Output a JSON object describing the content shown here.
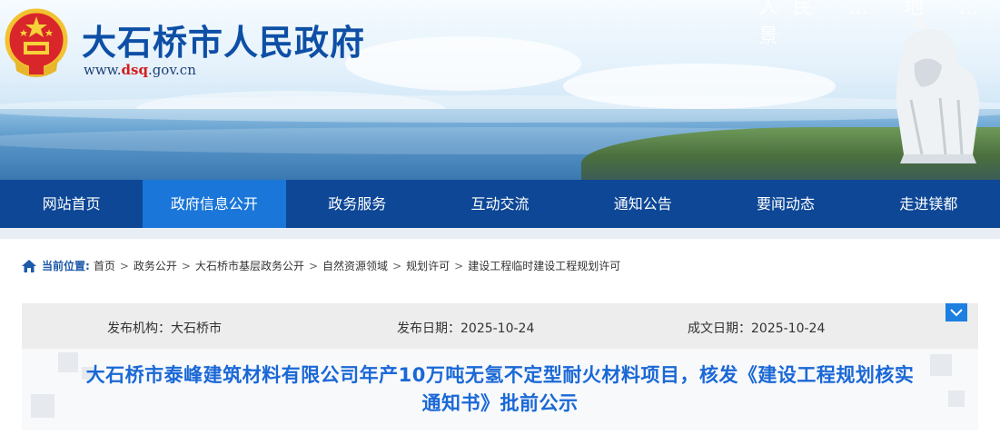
{
  "header": {
    "site_title": "大石桥市人民政府",
    "url_prefix": "www.",
    "url_highlight": "dsq",
    "url_suffix": ".gov.cn",
    "slogan": "人民 … 地 … 景"
  },
  "nav": {
    "items": [
      {
        "label": "网站首页",
        "active": false
      },
      {
        "label": "政府信息公开",
        "active": true
      },
      {
        "label": "政务服务",
        "active": false
      },
      {
        "label": "互动交流",
        "active": false
      },
      {
        "label": "通知公告",
        "active": false
      },
      {
        "label": "要闻动态",
        "active": false
      },
      {
        "label": "走进镁都",
        "active": false
      }
    ]
  },
  "breadcrumb": {
    "label": "当前位置:",
    "items": [
      "首页",
      "政务公开",
      "大石桥市基层政务公开",
      "自然资源领域",
      "规划许可",
      "建设工程临时建设工程规划许可"
    ],
    "separator": ">"
  },
  "meta": {
    "publisher": "发布机构：大石桥市",
    "publish_date": "发布日期：2025-10-24",
    "created_date": "成文日期：2025-10-24"
  },
  "article": {
    "title_line1": "大石桥市泰峰建筑材料有限公司年产10万吨无氢不定型耐火材料项目，核发《建设工程规划核实",
    "title_line2": "通知书》批前公示"
  },
  "colors": {
    "nav_bg": "#0d4796",
    "nav_active": "#1a76d8",
    "title_blue": "#1a68d6",
    "site_title": "#0e4fa6",
    "url_red": "#d51f1f"
  }
}
